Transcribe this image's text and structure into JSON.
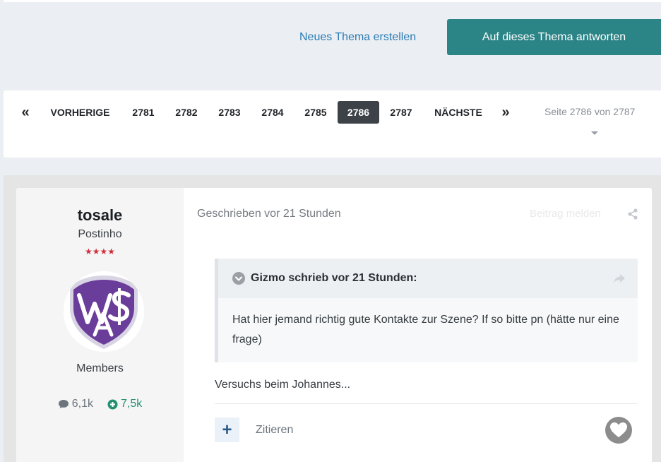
{
  "actions": {
    "new_topic": "Neues Thema erstellen",
    "reply": "Auf dieses Thema antworten"
  },
  "pagination": {
    "first": "«",
    "prev": "VORHERIGE",
    "pages": [
      "2781",
      "2782",
      "2783",
      "2784",
      "2785",
      "2786",
      "2787"
    ],
    "current": "2786",
    "next": "NÄCHSTE",
    "last": "»",
    "page_of": "Seite 2786 von 2787"
  },
  "author": {
    "name": "tosale",
    "title": "Postinho",
    "stars": "★★★★",
    "group": "Members",
    "posts": "6,1k",
    "reputation": "7,5k",
    "avatar_icon": "club-crest-icon"
  },
  "post": {
    "meta": "Geschrieben vor 21 Stunden",
    "report": "Beitrag melden",
    "quote": {
      "cite": "Gizmo schrieb vor 21 Stunden:",
      "body": "Hat hier jemand richtig gute Kontakte zur Szene? If so bitte pn (hätte nur eine frage)"
    },
    "text": "Versuchs beim Johannes...",
    "quote_button": "Zitieren",
    "plus_label": "+"
  },
  "colors": {
    "reply_button": "#2b8486",
    "link": "#2a7bb4",
    "active_page": "#3d4148",
    "reputation": "#239071",
    "crest_purple": "#6a3d9a"
  }
}
